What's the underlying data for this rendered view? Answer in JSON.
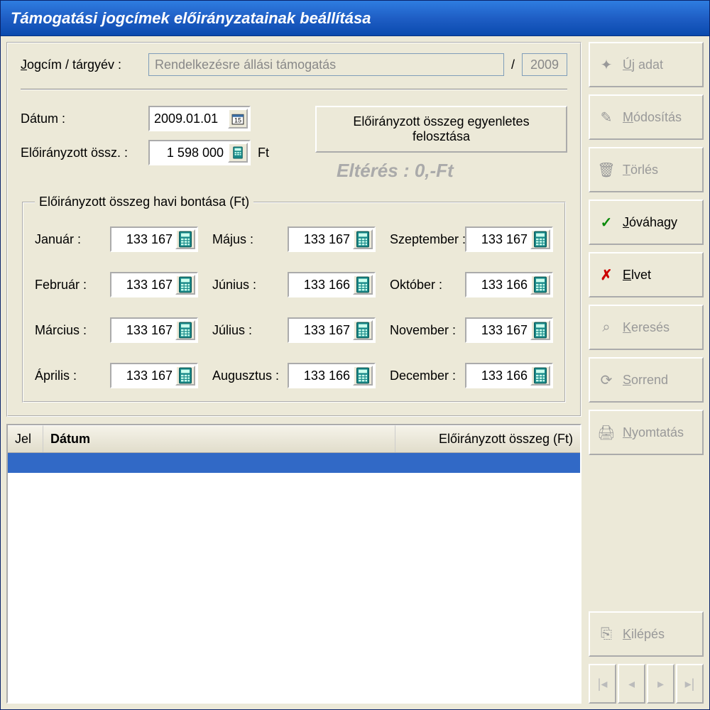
{
  "window": {
    "title": "Támogatási jogcímek előirányzatainak beállítása"
  },
  "form": {
    "jogcim_label": "Jogcím / tárgyév :",
    "jogcim_value": "Rendelkezésre állási támogatás",
    "year_separator": "/",
    "year": "2009",
    "datum_label": "Dátum :",
    "datum_value": "2009.01.01",
    "eloiranyzott_label": "Előirányzott össz. :",
    "eloiranyzott_value": "1 598 000",
    "currency": "Ft",
    "egyenletes_button": "Előirányzott összeg egyenletes felosztása",
    "elteres_label": "Eltérés : 0,-Ft",
    "fieldset_legend": "Előirányzott összeg havi bontása (Ft)"
  },
  "months": [
    {
      "label": "Január :",
      "value": "133 167"
    },
    {
      "label": "Május :",
      "value": "133 167"
    },
    {
      "label": "Szeptember :",
      "value": "133 167"
    },
    {
      "label": "Február :",
      "value": "133 167"
    },
    {
      "label": "Június :",
      "value": "133 166"
    },
    {
      "label": "Október :",
      "value": "133 166"
    },
    {
      "label": "Március :",
      "value": "133 167"
    },
    {
      "label": "Július :",
      "value": "133 167"
    },
    {
      "label": "November :",
      "value": "133 167"
    },
    {
      "label": "Április :",
      "value": "133 167"
    },
    {
      "label": "Augusztus :",
      "value": "133 166"
    },
    {
      "label": "December :",
      "value": "133 166"
    }
  ],
  "table": {
    "col_jel": "Jel",
    "col_datum": "Dátum",
    "col_osszeg": "Előirányzott összeg (Ft)"
  },
  "sidebar": {
    "new": "Új adat",
    "modify": "Módosítás",
    "delete": "Törlés",
    "approve": "Jóváhagy",
    "reject": "Elvet",
    "search": "Keresés",
    "sort": "Sorrend",
    "print": "Nyomtatás",
    "exit": "Kilépés"
  }
}
